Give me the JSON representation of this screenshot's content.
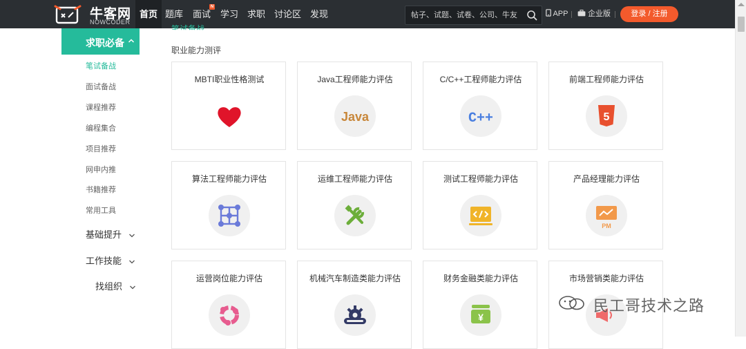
{
  "header": {
    "brand": "牛客网",
    "brand_sub": "NOWCODER",
    "nav": [
      "首页",
      "题库",
      "面试",
      "学习",
      "求职",
      "讨论区",
      "发现"
    ],
    "nav_badge": "N",
    "search_placeholder": "帖子、试题、试卷、公司、牛友",
    "app_label": "APP",
    "enterprise_label": "企业版",
    "login_label": "登录 / 注册",
    "accent": "#f35a2c",
    "bg": "#2b2f33"
  },
  "sidebar": {
    "active_group": "求职必备",
    "sub_items": [
      "笔试备战",
      "面试备战",
      "课程推荐",
      "编程集合",
      "项目推荐",
      "网申内推",
      "书籍推荐",
      "常用工具"
    ],
    "current_sub": "笔试备战",
    "groups": [
      "基础提升",
      "工作技能",
      "找组织"
    ],
    "accent": "#25bb9b"
  },
  "main": {
    "breadcrumb": "笔试备战",
    "section_title": "职业能力测评",
    "cards": [
      {
        "title": "MBTI职业性格测试",
        "icon": "heart-icon",
        "color": "#e0142a"
      },
      {
        "title": "Java工程师能力评估",
        "icon": "java-icon",
        "icon_text": "Java",
        "color": "#c8873a"
      },
      {
        "title": "C/C++工程师能力评估",
        "icon": "cpp-icon",
        "icon_text": "C++",
        "color": "#4a7fe0"
      },
      {
        "title": "前端工程师能力评估",
        "icon": "html5-icon",
        "icon_text": "5",
        "color": "#e8502e"
      },
      {
        "title": "算法工程师能力评估",
        "icon": "algorithm-icon",
        "color": "#6a7ad9"
      },
      {
        "title": "运维工程师能力评估",
        "icon": "tools-icon",
        "color": "#6cae3a"
      },
      {
        "title": "测试工程师能力评估",
        "icon": "code-icon",
        "color": "#f0b429"
      },
      {
        "title": "产品经理能力评估",
        "icon": "pm-icon",
        "icon_text": "PM",
        "color": "#f2994a"
      },
      {
        "title": "运营岗位能力评估",
        "icon": "operation-icon",
        "color": "#e75c8f"
      },
      {
        "title": "机械汽车制造类能力评估",
        "icon": "gear-icon",
        "color": "#333a66"
      },
      {
        "title": "财务金融类能力评估",
        "icon": "finance-icon",
        "icon_text": "¥",
        "color": "#8bc34a"
      },
      {
        "title": "市场营销类能力评估",
        "icon": "megaphone-icon",
        "color": "#f06a6a"
      }
    ]
  },
  "watermark": "民工哥技术之路"
}
